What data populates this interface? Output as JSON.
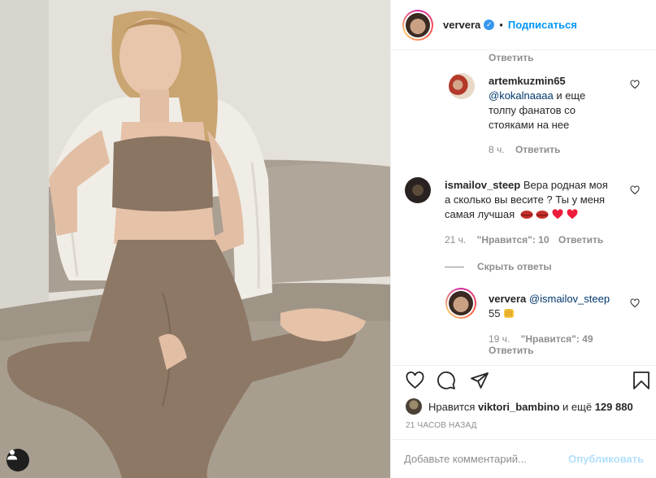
{
  "post": {
    "author": "ververa",
    "follow_label": "Подписаться",
    "separator": "•"
  },
  "comments": {
    "top_reply_label": "Ответить",
    "c1": {
      "user": "artemkuzmin65",
      "mention": "@kokalnaaaa",
      "text_line1": " и еще",
      "text_line2": "толпу фанатов со",
      "text_line3": "стояками на нее",
      "time": "8 ч.",
      "reply": "Ответить"
    },
    "c2": {
      "user": "ismailov_steep",
      "text_line1": " Вера родная моя",
      "text_line2": "а сколько вы весите ? Ты у меня",
      "text_line3": "самая лучшая",
      "time": "21 ч.",
      "likes": "\"Нравится\": 10",
      "reply": "Ответить",
      "hide_replies": "Скрыть ответы"
    },
    "c3": {
      "user": "ververa",
      "mention": "@ismailov_steep",
      "text_line2": "55",
      "time": "19 ч.",
      "likes": "\"Нравится\": 49",
      "reply": "Ответить"
    }
  },
  "likes": {
    "prefix": "Нравится",
    "user": "viktori_bambino",
    "suffix": "и ещё",
    "count": "129 880"
  },
  "time_ago": "21 ЧАСОВ НАЗАД",
  "add_comment": {
    "placeholder": "Добавьте комментарий...",
    "publish": "Опубликовать"
  },
  "colors": {
    "link": "#0095f6",
    "verified": "#3897f0",
    "muted": "#8e8e8e",
    "lips": "#c4302b",
    "heart": "#ed1c3a"
  }
}
